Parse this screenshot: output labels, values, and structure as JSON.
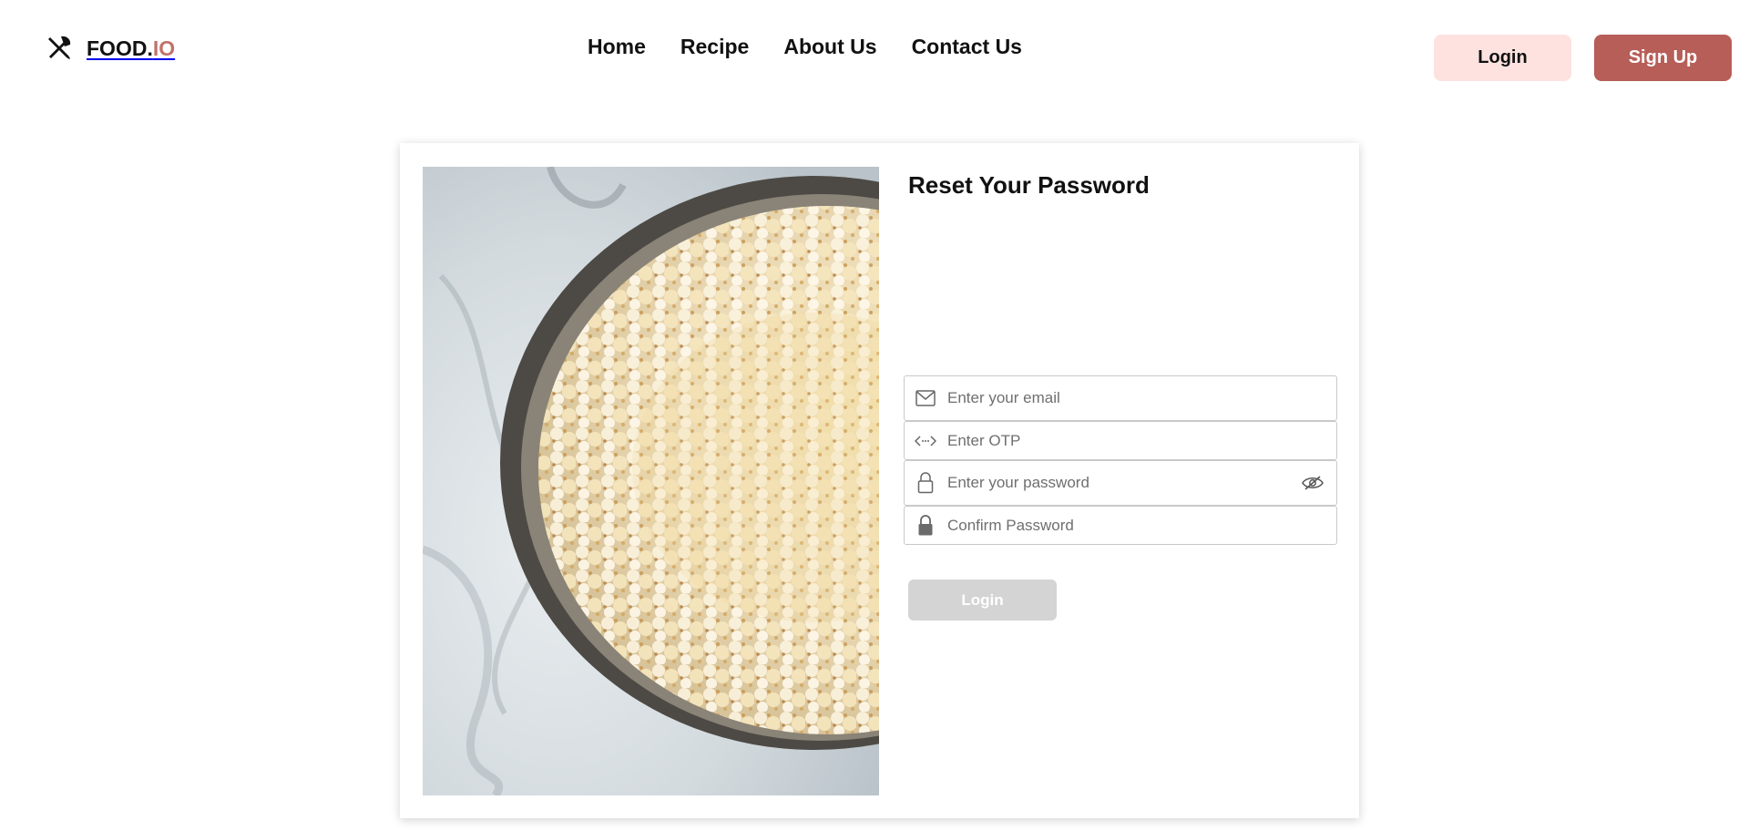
{
  "brand": {
    "name_part1": "FOOD.",
    "name_part2": "IO",
    "logo_icon": "fork-knife-icon",
    "accent_color": "#c0736a"
  },
  "nav": {
    "items": [
      {
        "label": "Home"
      },
      {
        "label": "Recipe"
      },
      {
        "label": "About Us"
      },
      {
        "label": "Contact Us"
      }
    ]
  },
  "header_actions": {
    "login_label": "Login",
    "signup_label": "Sign Up",
    "login_bg": "#fde2df",
    "signup_bg": "#b65e57"
  },
  "reset_form": {
    "title": "Reset Your Password",
    "image": "popcorn-bowl-photo",
    "fields": [
      {
        "icon": "mail-icon",
        "placeholder": "Enter your email",
        "value": ""
      },
      {
        "icon": "code-arrows-icon",
        "placeholder": "Enter OTP",
        "value": ""
      },
      {
        "icon": "lock-outline-icon",
        "placeholder": "Enter your password",
        "value": "",
        "trailing_icon": "eye-slash-icon"
      },
      {
        "icon": "lock-filled-icon",
        "placeholder": "Confirm Password",
        "value": ""
      }
    ],
    "submit_label": "Login",
    "submit_state": "disabled"
  }
}
